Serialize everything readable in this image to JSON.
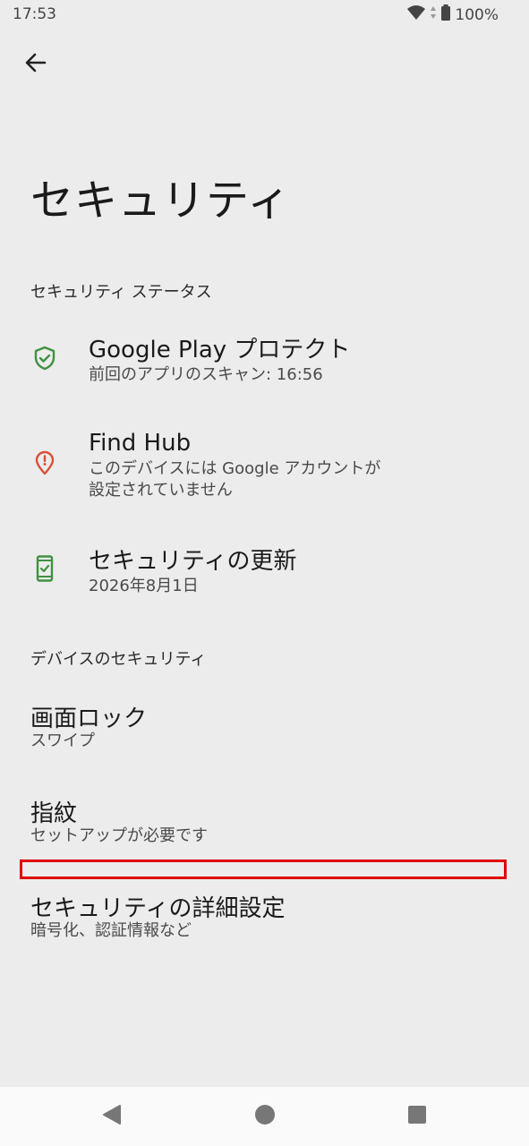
{
  "status_bar": {
    "time": "17:53",
    "battery": "100%"
  },
  "page": {
    "title": "セキュリティ"
  },
  "sections": {
    "status": {
      "header": "セキュリティ ステータス",
      "items": [
        {
          "title": "Google Play プロテクト",
          "subtitle": "前回のアプリのスキャン: 16:56",
          "icon": "shield-check-icon",
          "color": "#3f9142"
        },
        {
          "title": "Find Hub",
          "subtitle": "このデバイスには Google アカウントが\n設定されていません",
          "icon": "location-alert-icon",
          "color": "#d9503a"
        },
        {
          "title": "セキュリティの更新",
          "subtitle": "2026年8月1日",
          "icon": "phone-check-icon",
          "color": "#3f9142"
        }
      ]
    },
    "device": {
      "header": "デバイスのセキュリティ",
      "items": [
        {
          "title": "画面ロック",
          "subtitle": "スワイプ"
        },
        {
          "title": "指紋",
          "subtitle": "セットアップが必要です"
        },
        {
          "title": "セキュリティの詳細設定",
          "subtitle": "暗号化、認証情報など"
        }
      ]
    }
  },
  "colors": {
    "background": "#ececec",
    "highlight": "#e00000",
    "nav_bar": "#fafafa"
  },
  "nav": {
    "icons": [
      "back-triangle-icon",
      "home-circle-icon",
      "recents-square-icon"
    ]
  }
}
